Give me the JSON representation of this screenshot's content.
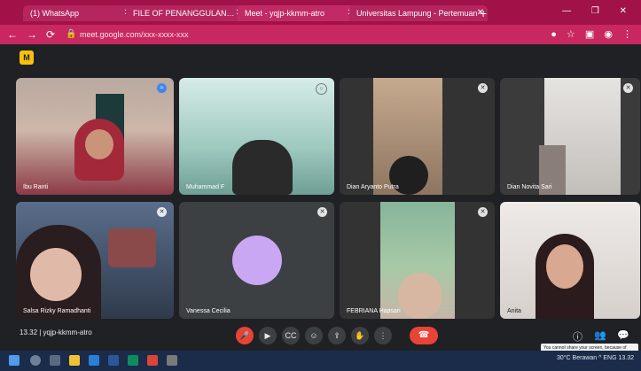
{
  "browser": {
    "tabs": [
      {
        "label": "(1) WhatsApp",
        "state": "inactive"
      },
      {
        "label": "FILE OF PENANGGULANGA...",
        "state": "inactive"
      },
      {
        "label": "Meet - yqjp-kkmm-atro",
        "state": "active"
      },
      {
        "label": "Universitas Lampung - Pertemuan",
        "state": "inactive"
      }
    ],
    "new_tab": "+",
    "url": "meet.google.com/xxx-xxxx-xxx",
    "window_controls": "— ❐ ✕"
  },
  "meet": {
    "logo_icon": "google-meet-icon",
    "participants": [
      {
        "name": "Ibu Ranti"
      },
      {
        "name": "Muhammad F"
      },
      {
        "name": "Dian Aryanto Putra"
      },
      {
        "name": "Dian Novita Sari"
      },
      {
        "name": "Salsa Rizky Ramadhanti"
      },
      {
        "name": "Vanessa Cecilia"
      },
      {
        "name": "FEBRIANA Hapsari"
      },
      {
        "name": "Anita"
      }
    ],
    "meeting_info": "13.32  |  yqjp-kkmm-atro",
    "tooltip": "You cannot share your screen, because of another app is running..."
  },
  "controls": {
    "buttons": [
      "mic-icon",
      "camera-icon",
      "captions-icon",
      "emoji-icon",
      "present-icon",
      "raise-hand-icon",
      "more-icon"
    ],
    "end_call": "call-end-icon"
  },
  "taskbar": {
    "tray_text": "30°C  Berawan  ^  ENG  13.32"
  },
  "colors": {
    "browser_accent": "#a01248",
    "meet_bg": "#202124",
    "end_call": "#ea4335",
    "avatar": "#c9a7f2"
  }
}
